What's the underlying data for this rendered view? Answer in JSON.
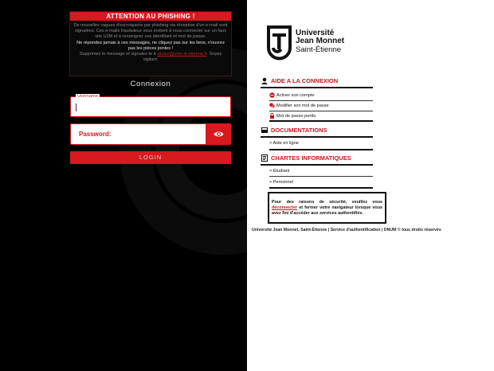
{
  "phishing": {
    "title": "ATTENTION AU PHISHING !",
    "line1": "De nouvelles vagues d'escroquerie par phishing via réception d'un e-mail sont signalées. Ces e-mails frauduleux vous invitent à vous connecter sur un faux site UJM et à renseigner vos identifiant et mot de passe.",
    "line2": "Ne répondez jamais à ces messages, ne cliquez pas sur les liens, n'ouvrez pas les pièces jointes !",
    "line3_prefix": "Supprimez le message et signalez-le à ",
    "line3_link": "abuse@univ-st-etienne.fr",
    "line3_suffix": ". Soyez vigilant."
  },
  "login": {
    "heading": "Connexion",
    "username_label": "Username",
    "password_label": "Password:",
    "button": "LOGIN"
  },
  "brand": {
    "line1": "Université",
    "line2": "Jean Monnet",
    "line3": "Saint-Étienne"
  },
  "sections": {
    "aide": {
      "title": "AIDE A LA CONNEXION",
      "items": [
        "Activer son compte",
        "Modifier son mot de passe",
        "Mot de passe perdu"
      ]
    },
    "docs": {
      "title": "DOCUMENTATIONS",
      "items": [
        "> Aide en ligne"
      ]
    },
    "chartes": {
      "title": "CHARTES INFORMATIQUES",
      "items": [
        "> Étudiant",
        "> Personnel"
      ]
    }
  },
  "warning": {
    "prefix": "Pour des raisons de sécurité, veuillez vous ",
    "link": "déconnecter",
    "suffix": " et fermer votre navigateur lorsque vous avez fini d'accéder aux services authentifiés."
  },
  "footer": "Université Jean Monnet, Saint-Étienne | Service d'authentification | DNUM © tous droits réservés",
  "colors": {
    "accent": "#d71920",
    "panel": "#000000"
  }
}
